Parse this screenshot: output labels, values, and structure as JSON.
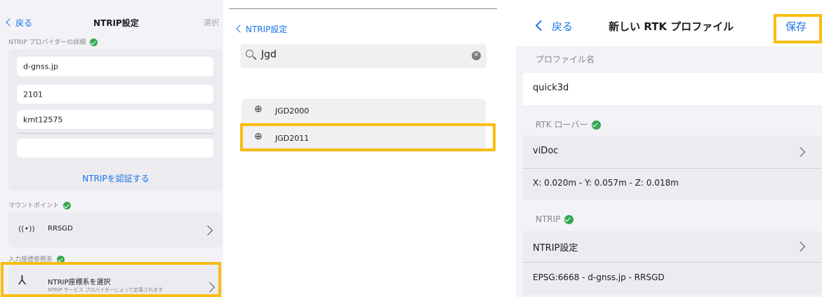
{
  "panel1": {
    "back_label": "戻る",
    "title": "NTRIP設定",
    "select_label": "選択",
    "provider_header": "NTRIP プロバイダーの詳細",
    "fields": [
      "d-gnss.jp",
      "2101",
      "kmt12575",
      ""
    ],
    "auth_button": "NTRIPを認証する",
    "mountpoint_header": "マウントポイント",
    "mountpoint_value": "RRSGD",
    "coord_header": "入力座標参照系",
    "coord_select_title": "NTRIP座標系を選択",
    "coord_select_sub": "NTRIP サービス プロバイダーによって定義されます"
  },
  "panel2": {
    "back_label": "NTRIP設定",
    "search_value": "Jgd",
    "results": [
      "JGD2000",
      "JGD2011"
    ]
  },
  "panel3": {
    "back_label": "戻る",
    "title": "新しい RTK プロファイル",
    "save_label": "保存",
    "profile_header": "プロファイル名",
    "profile_value": "quick3d",
    "rover_header": "RTK ローバー",
    "rover_value": "viDoc",
    "rover_accuracy": "X: 0.020m - Y: 0.057m - Z: 0.018m",
    "ntrip_header": "NTRIP",
    "ntrip_row": "NTRIP設定",
    "ntrip_summary": "EPSG:6668 - d-gnss.jp - RRSGD"
  },
  "colors": {
    "accent": "#1a73e8",
    "highlight": "#f9bd13",
    "ok": "#34a853",
    "group_bg": "#f2f2f7"
  }
}
